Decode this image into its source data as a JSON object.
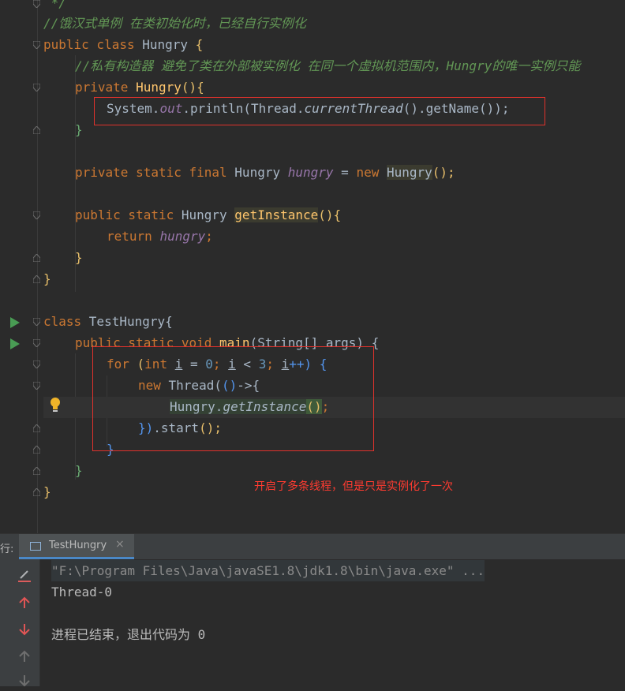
{
  "editor": {
    "lines": {
      "l0": " */",
      "l1": "//饿汉式单例 在类初始化时，已经自行实例化",
      "l2_kw": "public class ",
      "l2_name": "Hungry ",
      "l2_brace": "{",
      "l3": "//私有构造器 避免了类在外部被实例化 在同一个虚拟机范围内，Hungry的唯一实例只能",
      "l4_kw": "private ",
      "l4_name": "Hungry",
      "l4_rest": "(){",
      "l5_a": "System.",
      "l5_b": "out",
      "l5_c": ".println(Thread.",
      "l5_d": "currentThread",
      "l5_e": "().getName());",
      "l6": "}",
      "l8_kw": "private static final ",
      "l8_type": "Hungry ",
      "l8_field": "hungry",
      "l8_eq": " = ",
      "l8_new": "new ",
      "l8_ctor": "Hungry",
      "l8_end": "();",
      "l10_kw": "public static ",
      "l10_type": "Hungry ",
      "l10_fn": "getInstance",
      "l10_end": "(){",
      "l11_kw": "return ",
      "l11_field": "hungry",
      "l11_end": ";",
      "l12": "}",
      "l13": "}",
      "l15_kw": "class ",
      "l15_name": "TestHungry{",
      "l16_kw": "public static void ",
      "l16_fn": "main",
      "l16_rest": "(String[] args) {",
      "l17_kw": "for ",
      "l17_a": "(",
      "l17_int": "int ",
      "l17_i1": "i",
      "l17_b": " = ",
      "l17_n0": "0",
      "l17_c": "; ",
      "l17_i2": "i",
      "l17_d": " < ",
      "l17_n3": "3",
      "l17_e": "; ",
      "l17_i3": "i",
      "l17_f": "++) {",
      "l18_kw": "new ",
      "l18_a": "Thread(",
      "l18_b": "()",
      "l18_c": "->{",
      "l19_a": "Hungry.",
      "l19_b": "getInstance",
      "l19_c": "()",
      "l19_d": ";",
      "l20_a": "})",
      "l20_b": ".start",
      "l20_c": "();",
      "l21": "}",
      "l22": "}",
      "l23": "}"
    },
    "annotation": "开启了多条线程，但是只是实例化了一次"
  },
  "run_panel": {
    "label": "行:",
    "tab_title": "TestHungry",
    "tab_close": "×",
    "output": [
      "\"F:\\Program Files\\Java\\javaSE1.8\\jdk1.8\\bin\\java.exe\" ...",
      "Thread-0",
      "",
      "进程已结束，退出代码为 0"
    ]
  }
}
